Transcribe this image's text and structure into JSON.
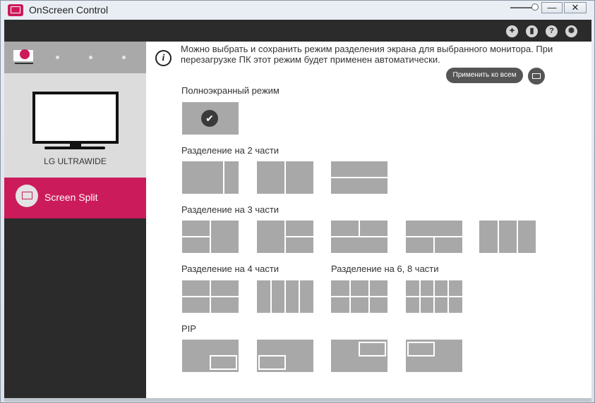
{
  "window": {
    "title": "OnScreen Control",
    "minimize_glyph": "—",
    "close_glyph": "✕"
  },
  "toolbar": {
    "icons": [
      "cursor-settings-icon",
      "display-icon",
      "help-icon",
      "settings-gear-icon"
    ]
  },
  "sidebar": {
    "monitor_name": "LG ULTRAWIDE",
    "items": [
      {
        "label": "Screen Split",
        "icon": "screen-split-icon"
      }
    ]
  },
  "main": {
    "info_text": "Можно выбрать и сохранить режим разделения экрана для выбранного монитора. При перезагрузке ПК этот режим будет применен автоматически.",
    "apply_all_label": "Применить ко всем",
    "sections": {
      "fullscreen": "Полноэкранный режим",
      "split2": "Разделение на 2 части",
      "split3": "Разделение на 3 части",
      "split4": "Разделение на 4 части",
      "split68": "Разделение на 6, 8 части",
      "pip": "PIP"
    },
    "selected_layout": "fullscreen"
  },
  "colors": {
    "accent": "#cc1b5a",
    "dark": "#2b2b2b",
    "layout_gray": "#a8a8a8"
  }
}
